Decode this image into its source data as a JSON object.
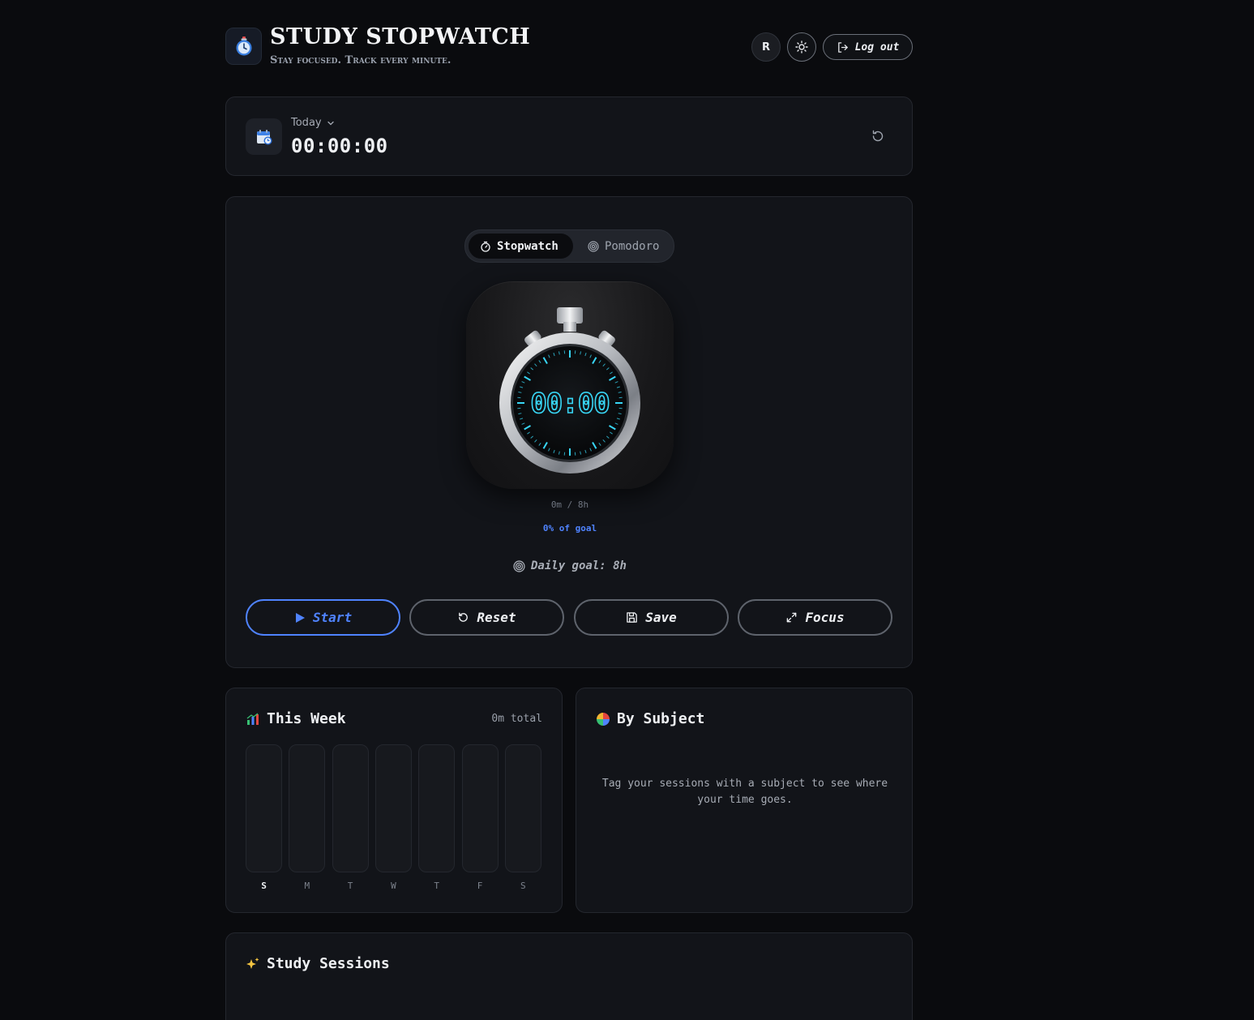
{
  "header": {
    "title": "STUDY STOPWATCH",
    "subtitle": "Stay focused. Track every minute.",
    "avatar_initial": "R",
    "logout_label": "Log out"
  },
  "today": {
    "label": "Today",
    "time": "00:00:00"
  },
  "modes": {
    "stopwatch_label": "Stopwatch",
    "pomodoro_label": "Pomodoro",
    "active": "Stopwatch"
  },
  "timer": {
    "display": "00:00",
    "goal_progress": "0m / 8h",
    "goal_percent": "0% of goal",
    "daily_goal": "Daily goal: 8h",
    "progress_fraction": 0
  },
  "actions": {
    "start": "Start",
    "reset": "Reset",
    "save": "Save",
    "focus": "Focus"
  },
  "week": {
    "title": "This Week",
    "total": "0m total",
    "days": [
      "S",
      "M",
      "T",
      "W",
      "T",
      "F",
      "S"
    ],
    "values_minutes": [
      0,
      0,
      0,
      0,
      0,
      0,
      0
    ],
    "current_day_index": 0
  },
  "subject": {
    "title": "By Subject",
    "empty_message": "Tag your sessions with a subject to see where your time goes."
  },
  "sessions": {
    "title": "Study Sessions"
  },
  "colors": {
    "accent": "#4f83ff",
    "digit": "#38d6f5",
    "background": "#0a0b0e",
    "card": "#121419"
  }
}
